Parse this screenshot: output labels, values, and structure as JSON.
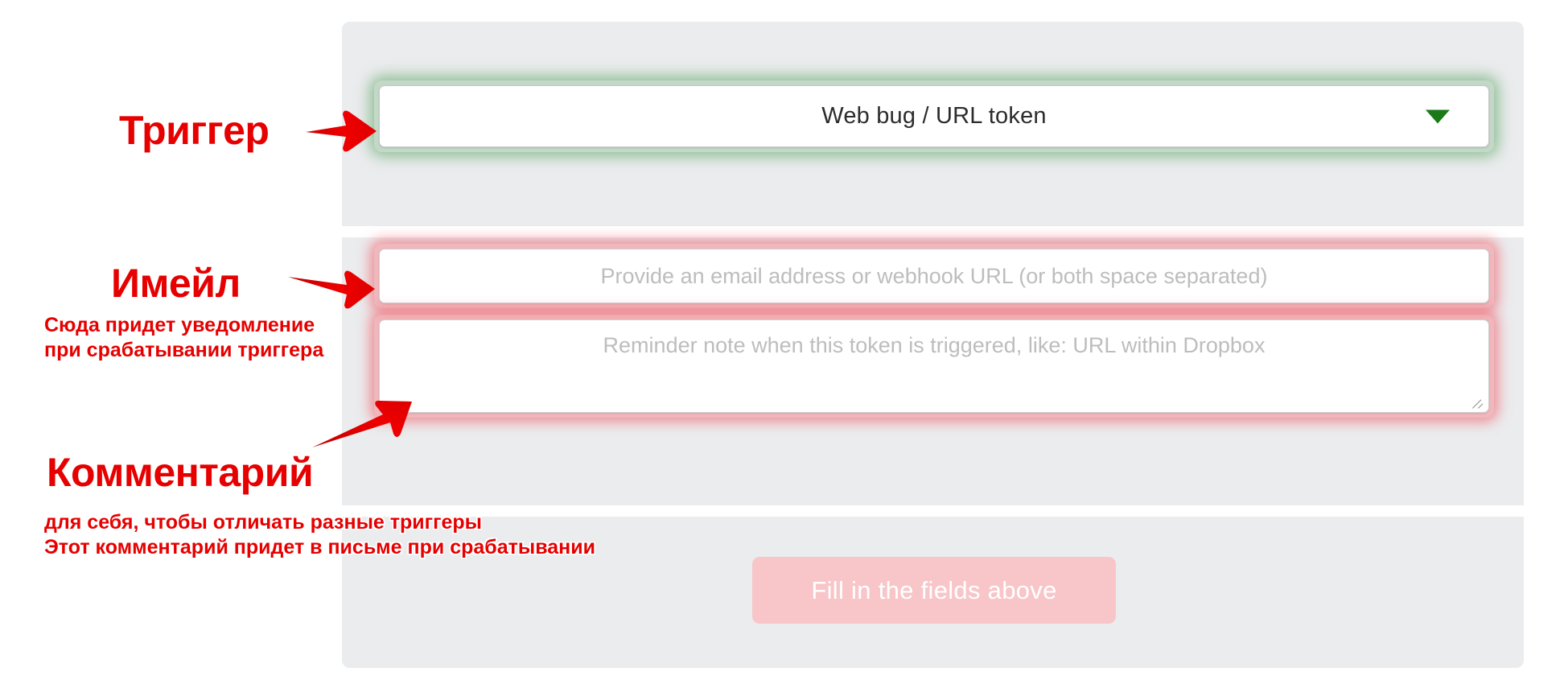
{
  "panel": {
    "trigger_section": {
      "select": {
        "selected_value": "Web bug / URL token",
        "caret_icon": "chevron-down-icon",
        "accent_color": "#1a7a1a"
      }
    },
    "fields_section": {
      "email_input": {
        "value": "",
        "placeholder": "Provide an email address or webhook URL (or both space separated)"
      },
      "note_textarea": {
        "value": "",
        "placeholder": "Reminder note when this token is triggered, like: URL within Dropbox"
      },
      "accent_color": "#f06470"
    },
    "action_section": {
      "submit_button": {
        "label": "Fill in the fields above",
        "background_color": "#f8c6c9",
        "text_color": "#ffffff"
      }
    },
    "background_color": "#ebecee"
  },
  "annotations": {
    "color": "#e60000",
    "trigger": {
      "title": "Триггер"
    },
    "email": {
      "title": "Имейл",
      "detail": "Сюда придет уведомление\nпри срабатывании триггера"
    },
    "comment": {
      "title": "Комментарий",
      "detail": "для себя, чтобы отличать разные триггеры\nЭтот комментарий придет в письме при срабатывании"
    }
  }
}
